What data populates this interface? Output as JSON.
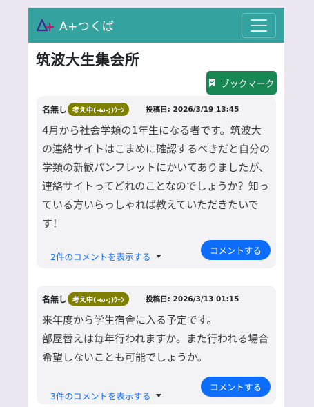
{
  "header": {
    "brand_text": "A+つくば",
    "logo_icon": "a-plus-logo-icon",
    "menu_icon": "hamburger-menu-icon"
  },
  "page_title": "筑波大生集会所",
  "bookmark": {
    "label": "ブックマーク",
    "icon": "bookmark-icon"
  },
  "posts": [
    {
      "author": "名無し",
      "badge": "考え中(-ω-;)ｳｰﾝ",
      "date": "投稿日: 2026/3/19 13:45",
      "body": "4月から社会学類の1年生になる者です。筑波大の連絡サイトはこまめに確認するべきだと自分の学類の新歓パンフレットにかいてありましたが、連絡サイトってどれのことなのでしょうか？知っている方いらっしゃれば教えていただきたいです！",
      "show_comments": "2件のコメントを表示する",
      "comment_button": "コメントする"
    },
    {
      "author": "名無し",
      "badge": "考え中(-ω-;)ｳｰﾝ",
      "date": "投稿日: 2026/3/13 01:15",
      "body": "来年度から学生宿舎に入る予定です。\n部屋替えは毎年行われますか。また行われる場合希望しないことも可能でしょうか。",
      "show_comments": "3件のコメントを表示する",
      "comment_button": "コメントする"
    }
  ],
  "colors": {
    "navbar": "#35a3a0",
    "bookmark_button": "#198754",
    "badge": "#808000",
    "primary": "#0d6efd"
  }
}
